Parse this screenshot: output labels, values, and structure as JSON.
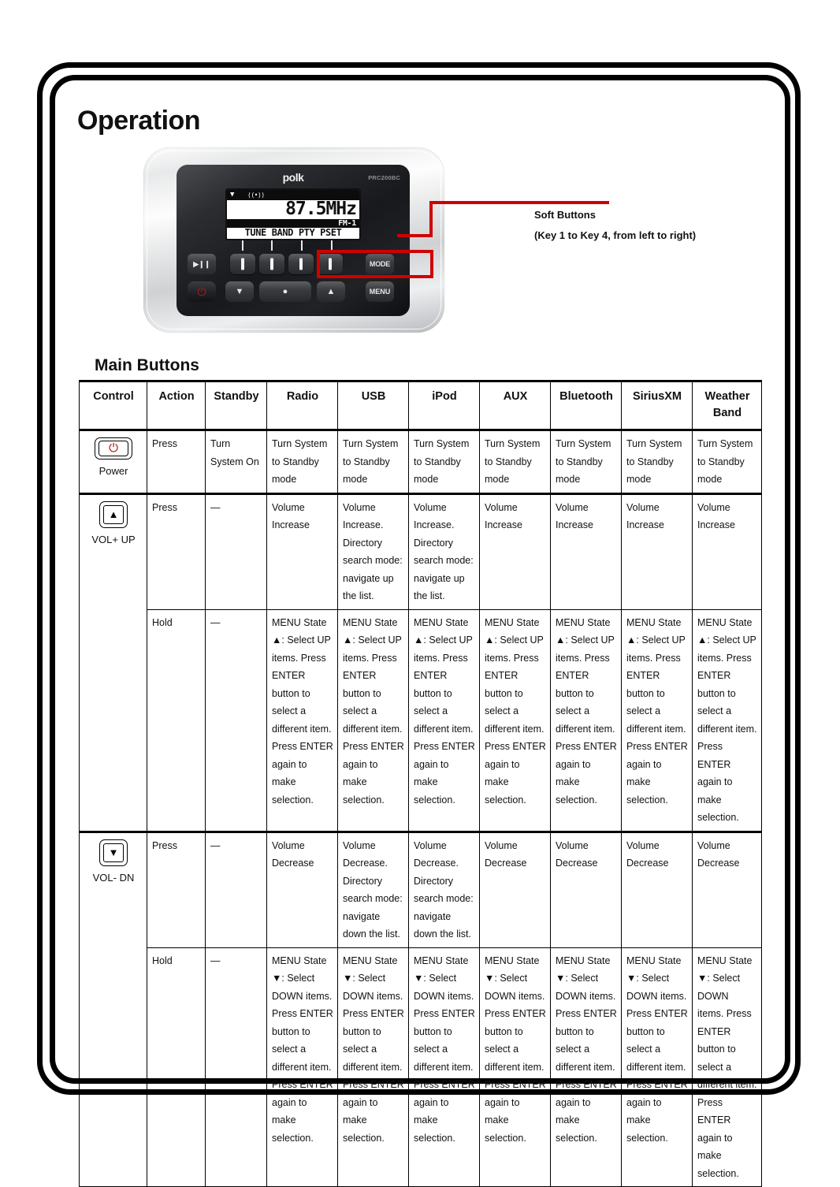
{
  "page": {
    "title": "Operation",
    "section_title": "Main Buttons"
  },
  "device": {
    "brand": "polk",
    "model": "PRC200BC",
    "lcd": {
      "antenna_icon": "antenna-icon",
      "signal_icon": "((•))",
      "frequency": "87.5MHz",
      "band": "FM-1",
      "soft_labels": "TUNE BAND PTY PSET"
    },
    "buttons": {
      "play_pause": "▶❙❙",
      "mode": "MODE",
      "menu": "MENU",
      "power_icon": "⏻",
      "down_icon": "▼",
      "enter_icon": "●",
      "up_icon": "▲"
    },
    "callout": {
      "line1": "Soft Buttons",
      "line2": "(Key 1 to Key 4, from left to right)",
      "color": "#d00000"
    }
  },
  "table": {
    "headers": [
      "Control",
      "Action",
      "Standby",
      "Radio",
      "USB",
      "iPod",
      "AUX",
      "Bluetooth",
      "SiriusXM",
      "Weather Band"
    ],
    "rows": [
      {
        "control_label": "Power",
        "control_icon": "power-button-icon",
        "action": "Press",
        "cells": [
          "Turn System On",
          "Turn System to Standby mode",
          "Turn System to Standby mode",
          "Turn System to Standby mode",
          "Turn System to Standby mode",
          "Turn System to Standby mode",
          "Turn System to Standby mode",
          "Turn System to Standby mode"
        ]
      },
      {
        "control_label": "VOL+ UP",
        "control_icon": "up-arrow-button-icon",
        "action": "Press",
        "cells": [
          "—",
          "Volume Increase",
          "Volume Increase. Directory search mode: navigate up the list.",
          "Volume Increase. Directory search mode: navigate up the list.",
          "Volume Increase",
          "Volume Increase",
          "Volume Increase",
          "Volume Increase"
        ]
      },
      {
        "control_label": "",
        "control_icon": "",
        "action": "Hold",
        "cells": [
          "—",
          "MENU State ▲: Select UP items. Press ENTER button to select a different item. Press ENTER again to make selection.",
          "MENU State ▲: Select UP items. Press ENTER button to select a different item. Press ENTER again to make selection.",
          "MENU State ▲: Select UP items. Press ENTER button to select a different item. Press ENTER again to make selection.",
          "MENU State ▲: Select UP items. Press ENTER button to select a different item. Press ENTER again to make selection.",
          "MENU State ▲: Select UP items. Press ENTER button to select a different item. Press ENTER again to make selection.",
          "MENU State ▲: Select UP items. Press ENTER button to select a different item. Press ENTER again to make selection.",
          "MENU State ▲: Select UP items. Press ENTER button to select a different item. Press ENTER again to make selection."
        ]
      },
      {
        "control_label": "VOL- DN",
        "control_icon": "down-arrow-button-icon",
        "action": "Press",
        "cells": [
          "—",
          "Volume Decrease",
          "Volume Decrease. Directory search mode: navigate down the list.",
          "Volume Decrease. Directory search mode: navigate down the list.",
          "Volume Decrease",
          "Volume Decrease",
          "Volume Decrease",
          "Volume Decrease"
        ]
      },
      {
        "control_label": "",
        "control_icon": "",
        "action": "Hold",
        "cells": [
          "—",
          "MENU State ▼: Select DOWN items. Press ENTER button to select a different item. Press ENTER again to make selection.",
          "MENU State ▼: Select DOWN items. Press ENTER button to select a different item. Press ENTER again to make selection.",
          "MENU State ▼: Select DOWN items. Press ENTER button to select a different item. Press ENTER again to make selection.",
          "MENU State ▼: Select DOWN items. Press ENTER button to select a different item. Press ENTER again to make selection.",
          "MENU State ▼: Select DOWN items. Press ENTER button to select a different item. Press ENTER again to make selection.",
          "MENU State ▼: Select DOWN items. Press ENTER button to select a different item. Press ENTER again to make selection.",
          "MENU State ▼: Select DOWN items. Press ENTER button to select a different item. Press ENTER again to make selection."
        ]
      }
    ]
  }
}
